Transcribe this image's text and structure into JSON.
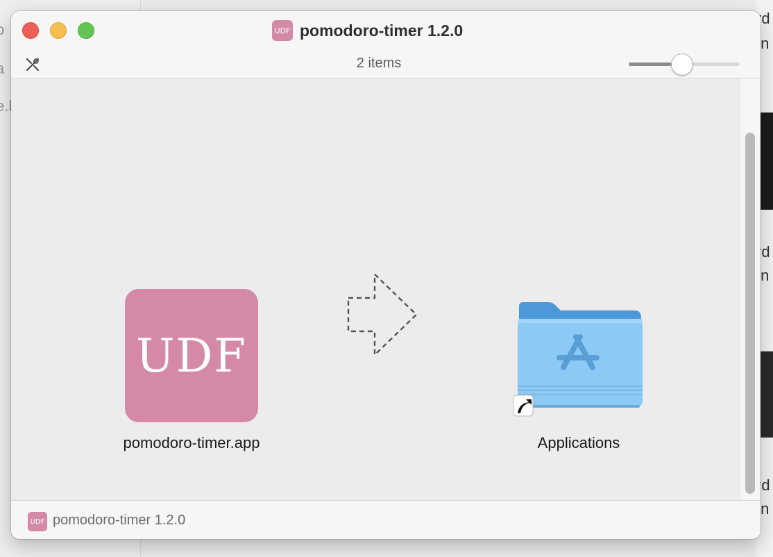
{
  "background": {
    "left_fragments": [
      "o",
      "a",
      "e.b"
    ],
    "right_fragments": [
      "rd",
      ".n",
      "rd",
      ".n",
      "rd",
      ".n"
    ]
  },
  "window": {
    "title": "pomodoro-timer 1.2.0",
    "title_icon_text": "UDF",
    "items_count": "2 items",
    "icon_size_slider_fraction": 0.38
  },
  "content": {
    "app": {
      "icon_text": "UDF",
      "label": "pomodoro-timer.app",
      "icon_color": "#d48aa7"
    },
    "arrow": {
      "icon": "dashed-arrow-right-icon"
    },
    "applications": {
      "label": "Applications",
      "icon": "applications-folder-icon",
      "alias_icon": "alias-arrow-icon"
    }
  },
  "statusbar": {
    "icon_text": "UDF",
    "text": "pomodoro-timer 1.2.0"
  },
  "colors": {
    "close": "#ee5f57",
    "minimize": "#f6be4f",
    "zoom": "#62c554",
    "app_pink": "#d48aa7",
    "folder_blue": "#8ccaf6"
  }
}
